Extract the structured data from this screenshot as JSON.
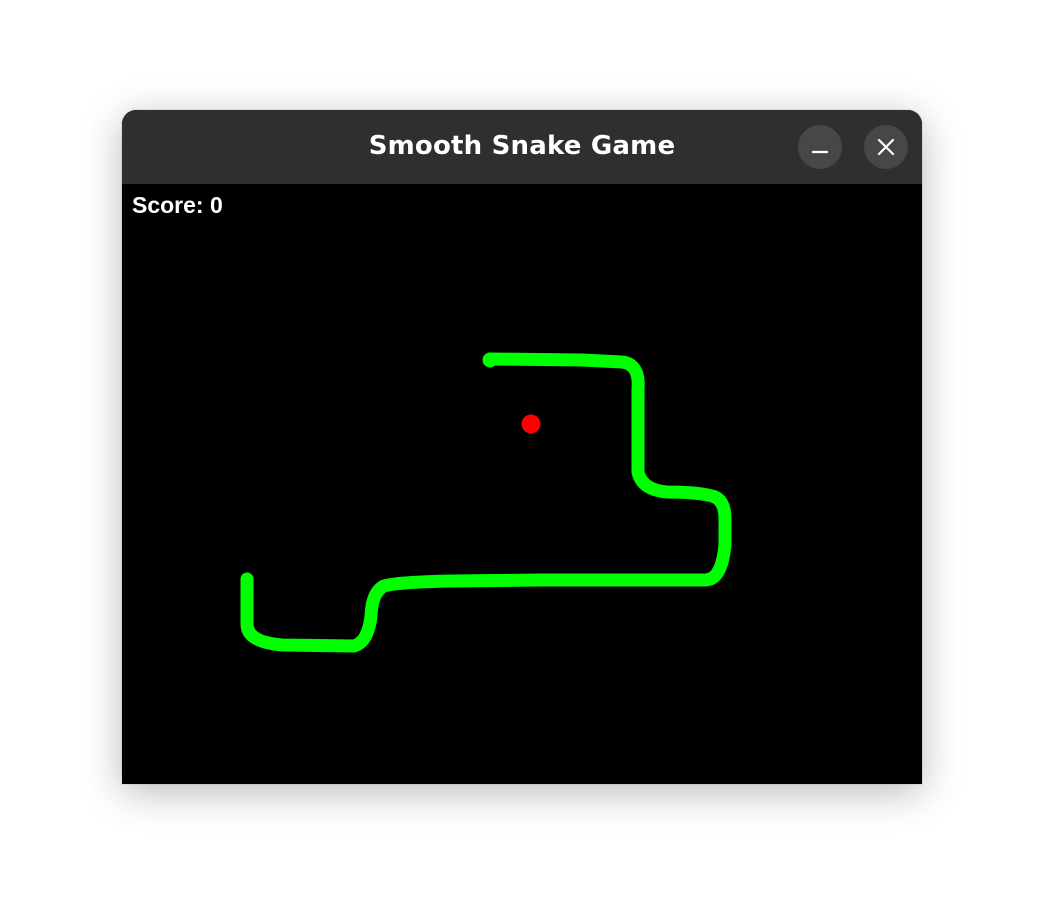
{
  "window": {
    "title": "Smooth Snake Game",
    "minimize_icon": "minimize-icon",
    "close_icon": "close-icon"
  },
  "game": {
    "score_label": "Score: 0",
    "score": 0,
    "snake_color": "#00ff00",
    "food_color": "#ff0000",
    "background_color": "#000000"
  }
}
